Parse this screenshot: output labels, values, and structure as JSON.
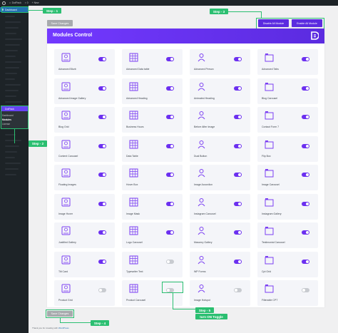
{
  "admin_bar": {
    "site_name": "DotPack",
    "comments_count": "0",
    "new_label": "+ New"
  },
  "sidebar": {
    "dashboard_label": "Dashboard",
    "plugin_label": "DotPack",
    "submenu": [
      "Dashboard",
      "Modules",
      "License"
    ]
  },
  "steps": {
    "step1": "Step - 1",
    "step2": "Step - 2",
    "step3": "Step - 3",
    "step4": "Step - 4",
    "step5": "Step - 5",
    "step5_caption": "turn ON Toggle"
  },
  "toolbar": {
    "save_top": "Save Changes",
    "disable_all": "Disable All Module",
    "enable_all": "Enable All Module"
  },
  "panel": {
    "title": "Modules Control"
  },
  "modules": [
    {
      "label": "Advanced Blurb",
      "icon": "blurb-icon",
      "enabled": true
    },
    {
      "label": "Advanced Data table",
      "icon": "table-icon",
      "enabled": true
    },
    {
      "label": "Advanced Person",
      "icon": "person-icon",
      "enabled": true
    },
    {
      "label": "Advanced Tabs",
      "icon": "tabs-icon",
      "enabled": true
    },
    {
      "label": "Advanced Image Gallery",
      "icon": "gallery-icon",
      "enabled": true
    },
    {
      "label": "Advanced Heading",
      "icon": "heading-icon",
      "enabled": true
    },
    {
      "label": "Animated Heading",
      "icon": "animated-heading-icon",
      "enabled": true
    },
    {
      "label": "Blog Carousel",
      "icon": "blog-carousel-icon",
      "enabled": true
    },
    {
      "label": "Blog Grid",
      "icon": "blog-grid-icon",
      "enabled": true
    },
    {
      "label": "Business Hours",
      "icon": "clock-icon",
      "enabled": true
    },
    {
      "label": "Before After Image",
      "icon": "before-after-icon",
      "enabled": true
    },
    {
      "label": "Contact Form 7",
      "icon": "form-icon",
      "enabled": true
    },
    {
      "label": "Content Carousel",
      "icon": "content-carousel-icon",
      "enabled": true
    },
    {
      "label": "Data Table",
      "icon": "data-table-icon",
      "enabled": true
    },
    {
      "label": "Dual Button",
      "icon": "dual-button-icon",
      "enabled": true
    },
    {
      "label": "Flip Box",
      "icon": "flip-box-icon",
      "enabled": true
    },
    {
      "label": "Floating Images",
      "icon": "floating-images-icon",
      "enabled": true
    },
    {
      "label": "Hover Box",
      "icon": "hover-box-icon",
      "enabled": true
    },
    {
      "label": "Image Accordion",
      "icon": "accordion-icon",
      "enabled": true
    },
    {
      "label": "Image Carousel",
      "icon": "image-carousel-icon",
      "enabled": true
    },
    {
      "label": "Image Hover",
      "icon": "image-hover-icon",
      "enabled": true
    },
    {
      "label": "Image Mask",
      "icon": "image-mask-icon",
      "enabled": true
    },
    {
      "label": "Instagram Carousel",
      "icon": "instagram-carousel-icon",
      "enabled": true
    },
    {
      "label": "Instagram Gallery",
      "icon": "instagram-gallery-icon",
      "enabled": true
    },
    {
      "label": "Justified Gallery",
      "icon": "justified-gallery-icon",
      "enabled": true
    },
    {
      "label": "Logo Carousel",
      "icon": "logo-carousel-icon",
      "enabled": true
    },
    {
      "label": "Masonry Gallery",
      "icon": "masonry-icon",
      "enabled": true
    },
    {
      "label": "Testimonial Carousel",
      "icon": "testimonial-icon",
      "enabled": true
    },
    {
      "label": "Tilt Card",
      "icon": "tilt-card-icon",
      "enabled": true
    },
    {
      "label": "Typewriter Text",
      "icon": "typewriter-icon",
      "enabled": false
    },
    {
      "label": "WP Forms",
      "icon": "wpforms-icon",
      "enabled": true
    },
    {
      "label": "Cpt Grid",
      "icon": "cpt-grid-icon",
      "enabled": true
    },
    {
      "label": "Product Grid",
      "icon": "product-grid-icon",
      "enabled": false
    },
    {
      "label": "Product Carousel",
      "icon": "product-carousel-icon",
      "enabled": false
    },
    {
      "label": "Image Hotspot",
      "icon": "hotspot-icon",
      "enabled": false
    },
    {
      "label": "Filterable CPT",
      "icon": "filterable-icon",
      "enabled": false
    }
  ],
  "footer": {
    "text": "Thank you for creating with",
    "link": "WordPress"
  },
  "colors": {
    "accent": "#5b2be0",
    "step": "#2bbf71",
    "toggle_on": "#6c30f0",
    "toggle_off": "#c8cbd0"
  }
}
